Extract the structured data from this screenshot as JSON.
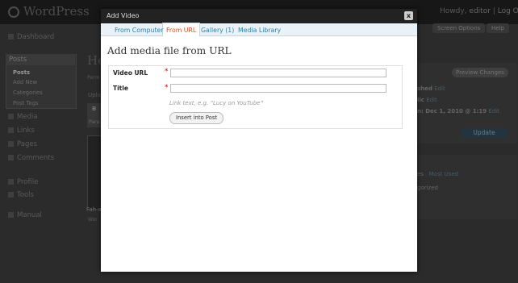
{
  "app": {
    "logo_text": "WordPress"
  },
  "header": {
    "howdy_prefix": "Howdy,",
    "user": "editor",
    "separator": "|",
    "logout": "Log Out"
  },
  "screen_options": "Screen Options",
  "help": "Help",
  "sidebar": {
    "dashboard": "Dashboard",
    "posts": "Posts",
    "submenu": [
      "Posts",
      "Add New",
      "Categories",
      "Post Tags"
    ],
    "media": "Media",
    "links": "Links",
    "pages": "Pages",
    "comments": "Comments",
    "profile": "Profile",
    "tools": "Tools",
    "manual": "Manual"
  },
  "main": {
    "title_partial": "He",
    "perm_partial": "Perm",
    "uplo_partial": "Uplo",
    "bold_btn": "B",
    "para_partial": "Para",
    "img_caption": "Fah a",
    "wor_partial": "Wor"
  },
  "publish_box": {
    "preview": "Preview Changes",
    "status_partial": "shed",
    "visibility_partial": "lic",
    "published_on": "n: Dec 1, 2010 @ 1:19",
    "edit": "Edit",
    "update": "Update"
  },
  "categories_box": {
    "tab_partial": "es",
    "most_used": "Most Used",
    "item_partial": "gorized"
  },
  "modal": {
    "title": "Add Video",
    "close": "x",
    "tabs": [
      {
        "label": "From Computer",
        "active": false
      },
      {
        "label": "From URL",
        "active": true
      },
      {
        "label": "Gallery (1)",
        "active": false
      },
      {
        "label": "Media Library",
        "active": false
      }
    ],
    "heading": "Add media file from URL",
    "fields": {
      "video_url_label": "Video URL",
      "video_url_value": "",
      "title_label": "Title",
      "title_value": "",
      "required_mark": "*"
    },
    "help_text": "Link text, e.g. “Lucy on YouTube”",
    "insert_button": "Insert into Post"
  },
  "colors": {
    "tab_link": "#2583ad",
    "tab_active": "#d54e21",
    "modal_title_bg": "#222222",
    "required": "#cc0000"
  }
}
